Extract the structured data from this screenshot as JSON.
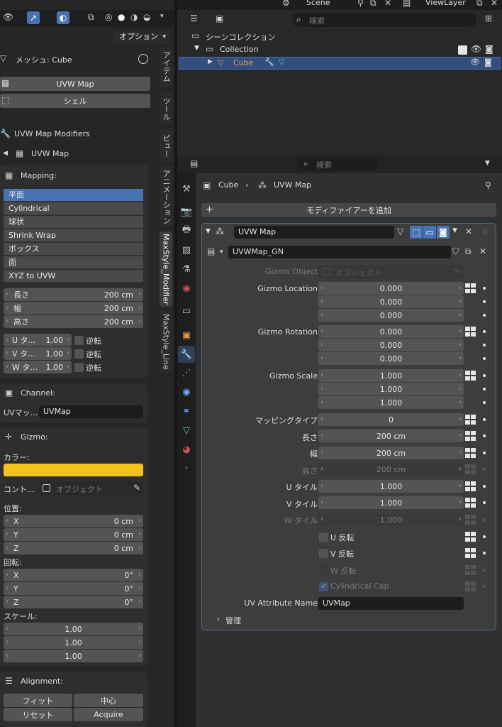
{
  "top_left": {
    "options_label": "オプション"
  },
  "sidepanel": {
    "mesh_label": "メッシュ: Cube",
    "btn_uvw": "UVW Map",
    "btn_shell": "シェル",
    "modifiers_title": "UVW Map Modifiers",
    "sub_title": "UVW Map",
    "mapping_title": "Mapping:",
    "mapping_items": [
      "平面",
      "Cylindrical",
      "球状",
      "Shrink Wrap",
      "ボックス",
      "面",
      "XYZ to UVW"
    ],
    "dims": [
      {
        "label": "長さ",
        "value": "200 cm"
      },
      {
        "label": "幅",
        "value": "200 cm"
      },
      {
        "label": "高さ",
        "value": "200 cm"
      }
    ],
    "tiles": [
      {
        "label": "U タ...",
        "value": "1.00",
        "flip": "逆転"
      },
      {
        "label": "V タ...",
        "value": "1.00",
        "flip": "逆転"
      },
      {
        "label": "W タ...",
        "value": "1.00",
        "flip": "逆転"
      }
    ],
    "channel_title": "Channel:",
    "uv_label": "UVマッ...",
    "uv_value": "UVMap",
    "gizmo_title": "Gizmo:",
    "color_label": "カラー:",
    "color": "#f5c21b",
    "control_label": "コント...",
    "object_placeholder": "オブジェクト",
    "position_label": "位置:",
    "position": [
      {
        "axis": "X",
        "value": "0 cm"
      },
      {
        "axis": "Y",
        "value": "0 cm"
      },
      {
        "axis": "Z",
        "value": "0 cm"
      }
    ],
    "rotation_label": "回転:",
    "rotation": [
      {
        "axis": "X",
        "value": "0°"
      },
      {
        "axis": "Y",
        "value": "0°"
      },
      {
        "axis": "Z",
        "value": "0°"
      }
    ],
    "scale_label": "スケール:",
    "scale": [
      "1.00",
      "1.00",
      "1.00"
    ],
    "alignment_title": "Alignment:",
    "align_buttons": [
      "フィット",
      "中心",
      "リセット",
      "Acquire"
    ]
  },
  "vtabs": [
    "アイテム",
    "ツール",
    "ビュー",
    "アニメーション",
    "MaxStyle_Modifier",
    "MaxStyle_Line"
  ],
  "outliner": {
    "scene": "Scene",
    "viewlayer": "ViewLayer",
    "search_placeholder": "検索",
    "scene_collection": "シーンコレクション",
    "collection": "Collection",
    "cube": "Cube"
  },
  "properties": {
    "search_placeholder": "検索",
    "breadcrumb_obj": "Cube",
    "breadcrumb_mod": "UVW Map",
    "add_modifier": "モディファイアーを追加",
    "modifier_name": "UVW Map",
    "nodegroup": "UVWMap_GN",
    "gizmo_object_label": "Gizmo Object",
    "gizmo_object_placeholder": "オブジェクト",
    "gizmo_location_label": "Gizmo Location",
    "gizmo_location": [
      "0.000",
      "0.000",
      "0.000"
    ],
    "gizmo_rotation_label": "Gizmo Rotation",
    "gizmo_rotation": [
      "0.000",
      "0.000",
      "0.000"
    ],
    "gizmo_scale_label": "Gizmo Scale",
    "gizmo_scale": [
      "1.000",
      "1.000",
      "1.000"
    ],
    "mapping_type_label": "マッピングタイプ",
    "mapping_type": "0",
    "length_label": "長さ",
    "length": "200 cm",
    "width_label": "幅",
    "width": "200 cm",
    "height_label": "高さ",
    "height": "200 cm",
    "u_tile_label": "U タイル",
    "u_tile": "1.000",
    "v_tile_label": "V タイル",
    "v_tile": "1.000",
    "w_tile_label": "W タイル",
    "w_tile": "1.000",
    "u_flip": "U 反転",
    "v_flip": "V 反転",
    "w_flip": "W 反転",
    "cyl_cap": "Cylindrical Cap",
    "uv_attr_label": "UV Attribute Name",
    "uv_attr": "UVMap",
    "manage": "管理"
  }
}
